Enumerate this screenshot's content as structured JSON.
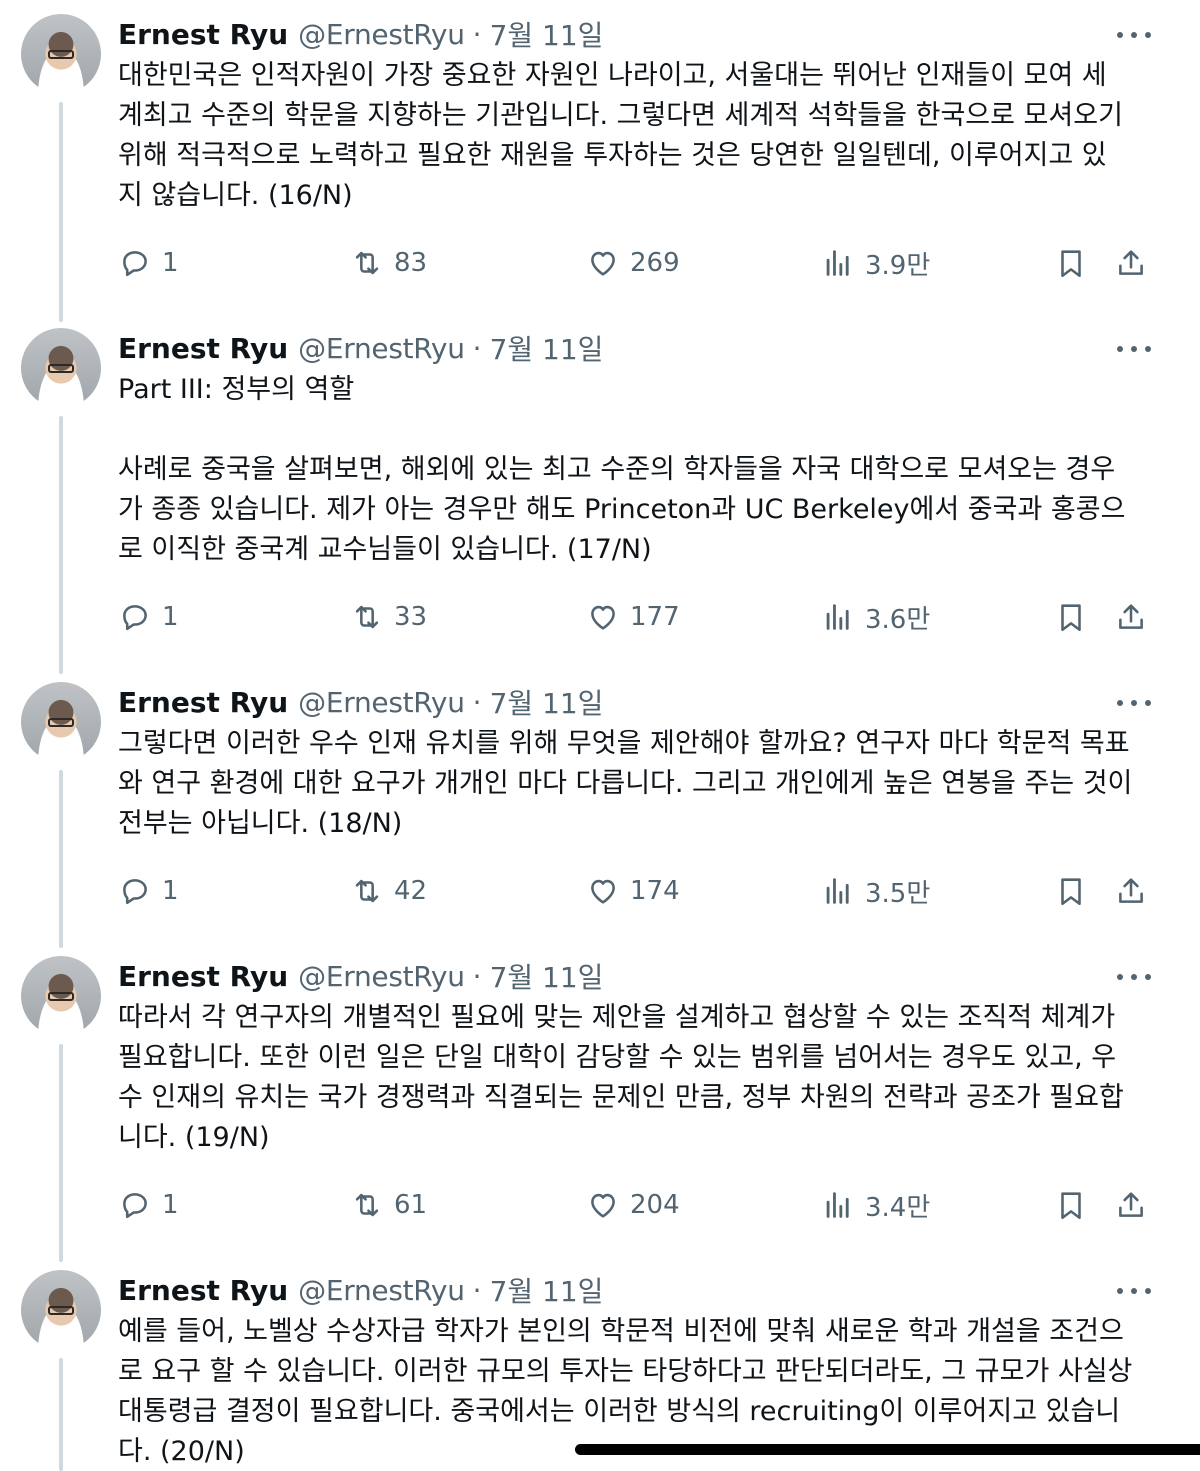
{
  "colors": {
    "text_primary": "#0f1419",
    "text_secondary": "#536471",
    "thread_line": "#cfd9de",
    "background": "#ffffff"
  },
  "tweets": [
    {
      "name": "Ernest Ryu",
      "handle": "@ErnestRyu",
      "separator": "·",
      "date": "7월 11일",
      "lines": [
        "대한민국은 인적자원이 가장 중요한 자원인 나라이고, 서울대는 뛰어난 인재들이 모여 세",
        "계최고 수준의 학문을 지향하는 기관입니다. 그렇다면 세계적 석학들을 한국으로 모셔오기",
        "위해 적극적으로 노력하고 필요한 재원을 투자하는 것은 당연한 일일텐데, 이루어지고 있",
        "지 않습니다. (16/N)"
      ],
      "replies": "1",
      "reposts": "83",
      "likes": "269",
      "views": "3.9만"
    },
    {
      "name": "Ernest Ryu",
      "handle": "@ErnestRyu",
      "separator": "·",
      "date": "7월 11일",
      "lines": [
        "Part III: 정부의 역할",
        "",
        "사례로 중국을 살펴보면, 해외에 있는 최고 수준의 학자들을 자국 대학으로 모셔오는 경우",
        "가 종종 있습니다. 제가 아는 경우만 해도 Princeton과 UC Berkeley에서 중국과 홍콩으",
        "로 이직한 중국계 교수님들이 있습니다. (17/N)"
      ],
      "replies": "1",
      "reposts": "33",
      "likes": "177",
      "views": "3.6만"
    },
    {
      "name": "Ernest Ryu",
      "handle": "@ErnestRyu",
      "separator": "·",
      "date": "7월 11일",
      "lines": [
        "그렇다면 이러한 우수 인재 유치를 위해 무엇을 제안해야 할까요? 연구자 마다 학문적 목표",
        "와 연구 환경에 대한 요구가 개개인 마다 다릅니다. 그리고 개인에게 높은 연봉을 주는 것이",
        "전부는 아닙니다. (18/N)"
      ],
      "replies": "1",
      "reposts": "42",
      "likes": "174",
      "views": "3.5만"
    },
    {
      "name": "Ernest Ryu",
      "handle": "@ErnestRyu",
      "separator": "·",
      "date": "7월 11일",
      "lines": [
        "따라서 각 연구자의 개별적인 필요에 맞는 제안을 설계하고 협상할 수 있는 조직적 체계가",
        "필요합니다. 또한 이런 일은 단일 대학이 감당할 수 있는 범위를 넘어서는 경우도 있고, 우",
        "수 인재의 유치는 국가 경쟁력과 직결되는 문제인 만큼, 정부 차원의 전략과 공조가 필요합",
        "니다. (19/N)"
      ],
      "replies": "1",
      "reposts": "61",
      "likes": "204",
      "views": "3.4만"
    },
    {
      "name": "Ernest Ryu",
      "handle": "@ErnestRyu",
      "separator": "·",
      "date": "7월 11일",
      "lines": [
        "예를 들어, 노벨상 수상자급 학자가 본인의 학문적 비전에 맞춰 새로운 학과 개설을 조건으",
        "로 요구 할 수 있습니다. 이러한 규모의 투자는 타당하다고 판단되더라도, 그 규모가 사실상",
        "대통령급 결정이 필요합니다. 중국에서는 이러한 방식의 recruiting이 이루어지고 있습니",
        "다. (20/N)"
      ]
    }
  ]
}
